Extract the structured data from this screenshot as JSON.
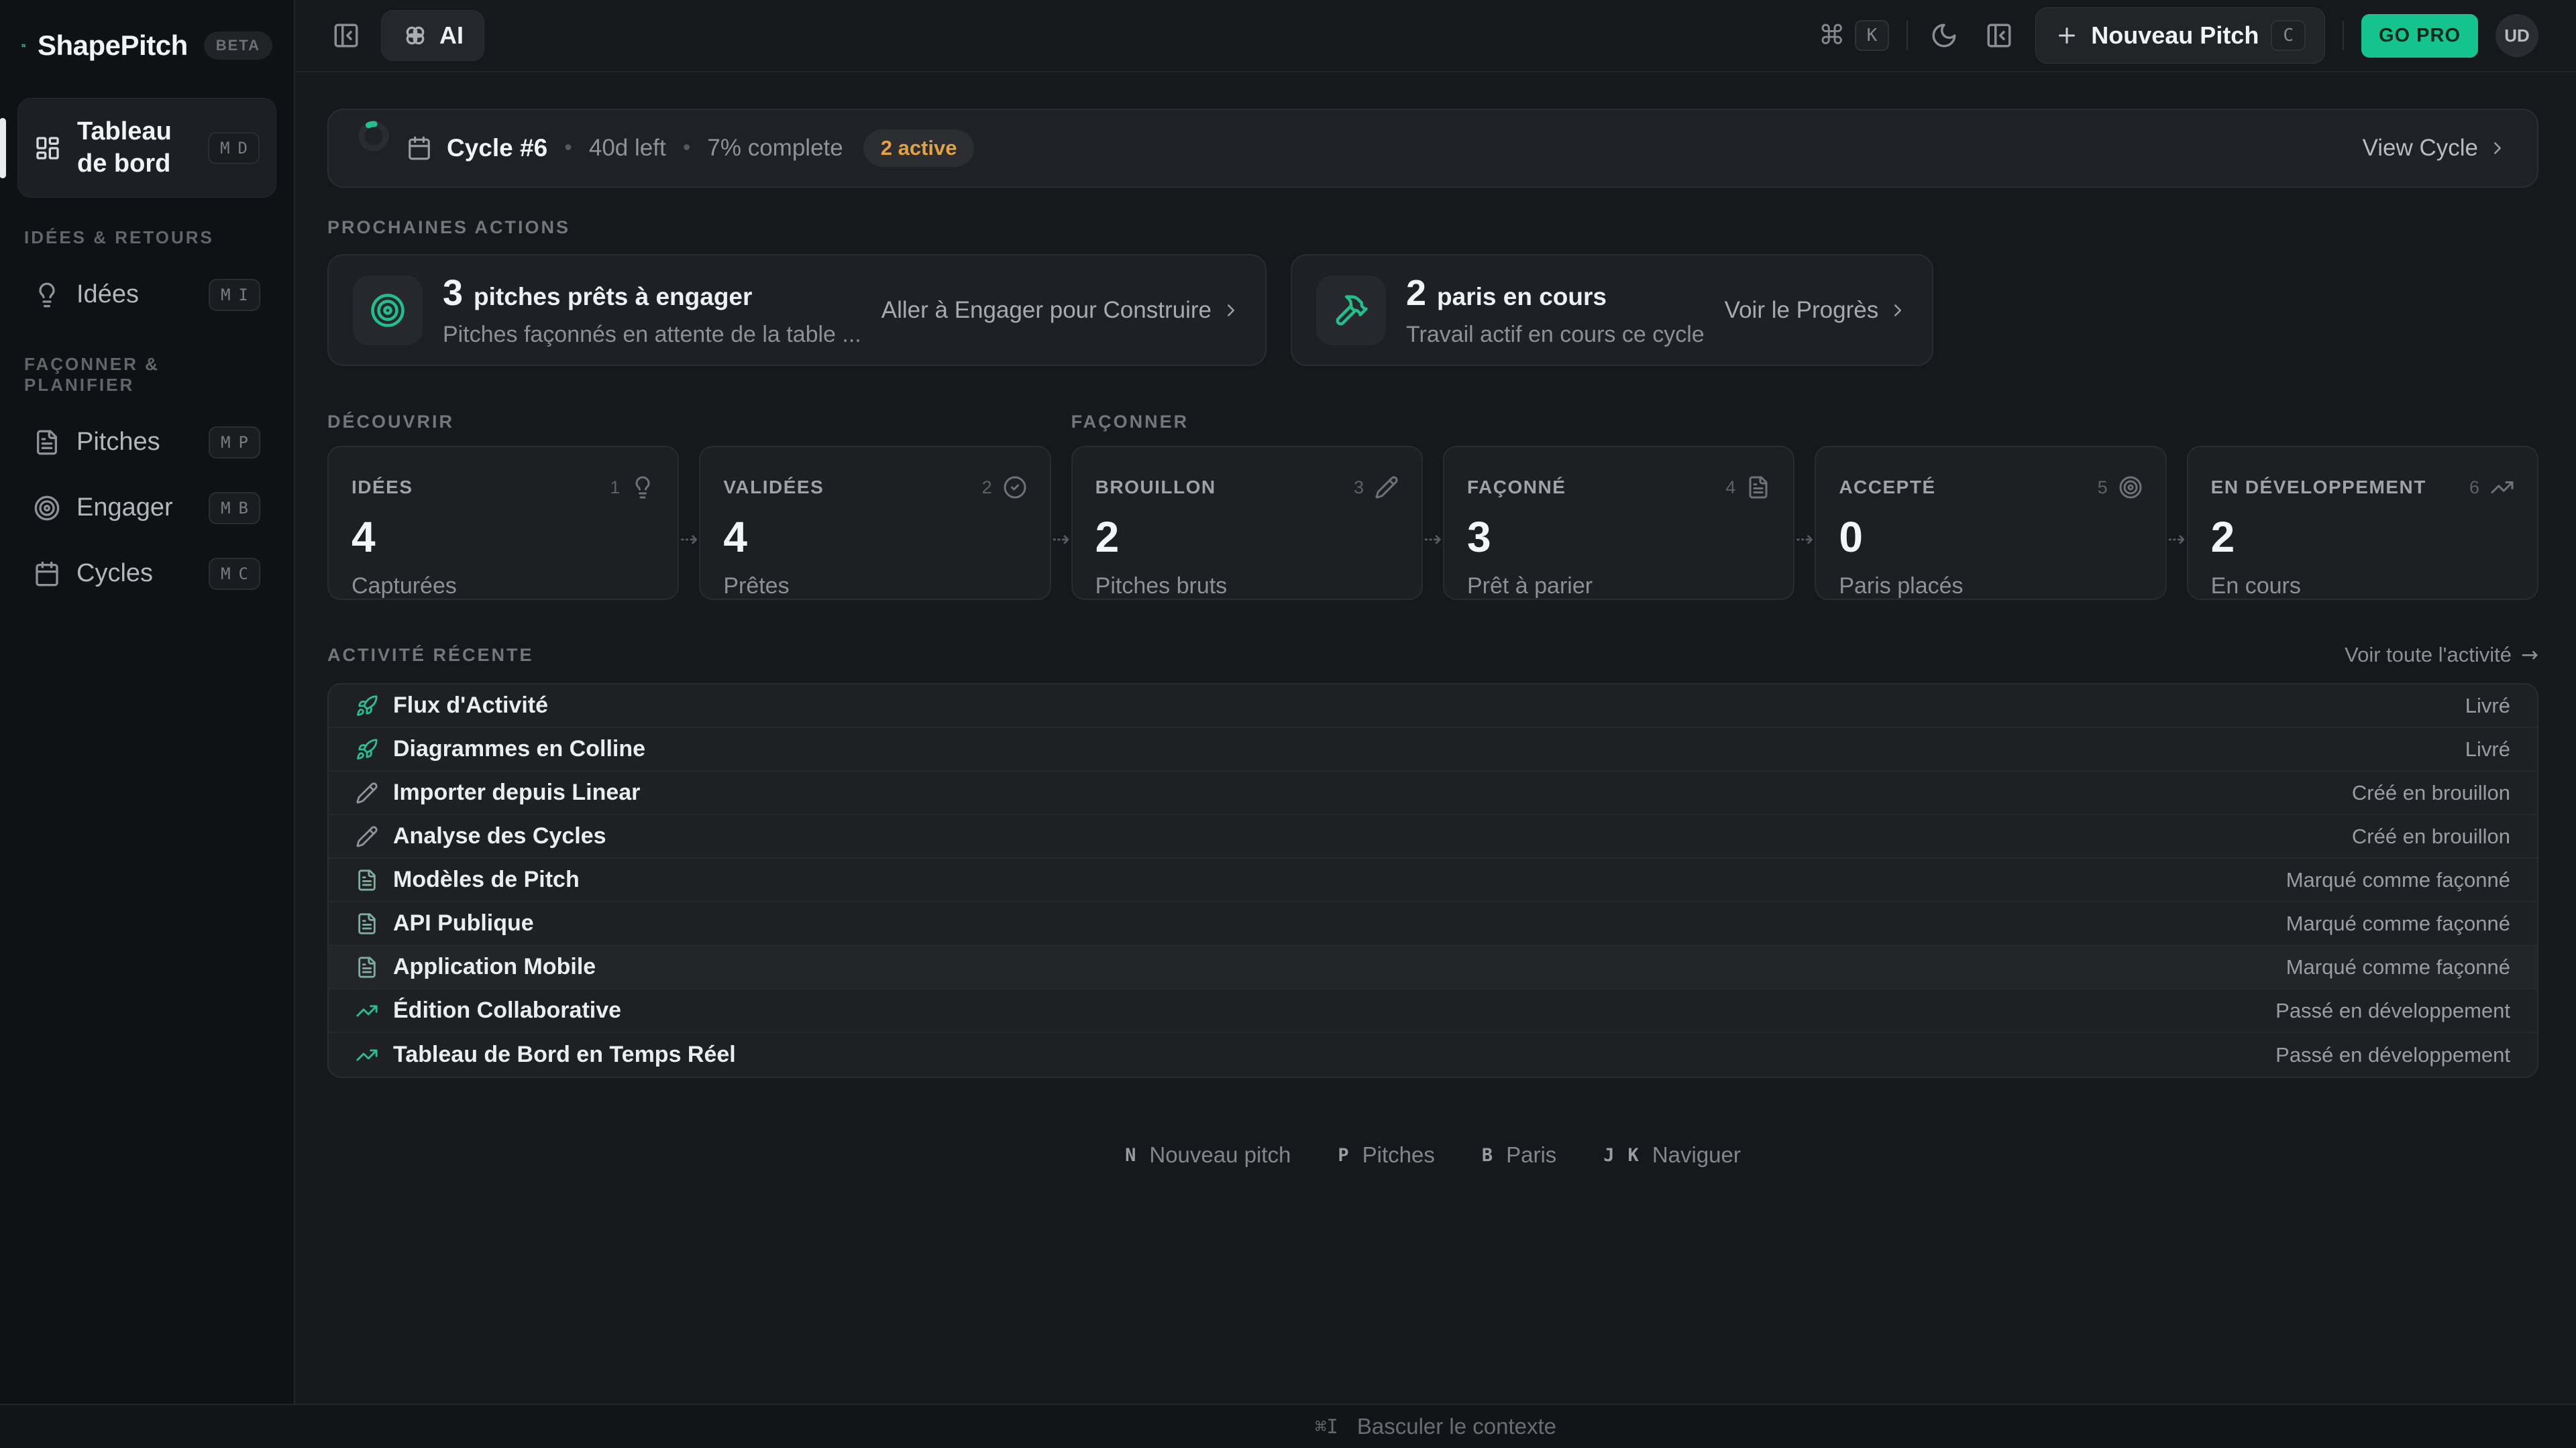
{
  "colors": {
    "accent": "#21c08b",
    "amber": "#e3a23f",
    "sidebar_bg": "#101114",
    "main_bg": "#17181c",
    "card_bg": "#1e2025"
  },
  "brand": {
    "name": "ShapePitch",
    "badge": "BETA"
  },
  "topbar": {
    "ai_label": "AI",
    "cmd_symbol": "⌘",
    "k_key": "K",
    "new_pitch_label": "Nouveau Pitch",
    "new_pitch_key": "C",
    "go_pro_label": "GO PRO",
    "avatar_initials": "UD"
  },
  "sidebar": {
    "dashboard": {
      "label": "Tableau de bord",
      "key1": "M",
      "key2": "D"
    },
    "section_ideas": "IDÉES & RETOURS",
    "idees": {
      "label": "Idées",
      "key1": "M",
      "key2": "I"
    },
    "section_shape": "FAÇONNER & PLANIFIER",
    "pitches": {
      "label": "Pitches",
      "key1": "M",
      "key2": "P"
    },
    "engager": {
      "label": "Engager",
      "key1": "M",
      "key2": "B"
    },
    "cycles": {
      "label": "Cycles",
      "key1": "M",
      "key2": "C"
    }
  },
  "cycle_banner": {
    "title": "Cycle #6",
    "dot": "•",
    "days_left": "40d left",
    "progress": "7% complete",
    "active_badge": "2 active",
    "action_label": "View Cycle"
  },
  "next_actions": {
    "section_label": "PROCHAINES ACTIONS",
    "cards": [
      {
        "count": "3",
        "title": "pitches prêts à engager",
        "subtitle": "Pitches façonnés en attente de la table ...",
        "action_label": "Aller à Engager pour Construire",
        "icon": "target-icon"
      },
      {
        "count": "2",
        "title": "paris en cours",
        "subtitle": "Travail actif en cours ce cycle",
        "action_label": "Voir le Progrès",
        "icon": "hammer-icon"
      }
    ]
  },
  "pipeline": {
    "groups": [
      {
        "label": "DÉCOUVRIR"
      },
      {
        "label": "FAÇONNER"
      }
    ],
    "flow_arrow": "⇢",
    "cards": [
      {
        "label": "IDÉES",
        "step": "1",
        "icon": "lightbulb-icon",
        "value": "4",
        "sublabel": "Capturées"
      },
      {
        "label": "VALIDÉES",
        "step": "2",
        "icon": "check-circle-icon",
        "value": "4",
        "sublabel": "Prêtes"
      },
      {
        "label": "BROUILLON",
        "step": "3",
        "icon": "pencil-icon",
        "value": "2",
        "sublabel": "Pitches bruts"
      },
      {
        "label": "FAÇONNÉ",
        "step": "4",
        "icon": "file-text-icon",
        "value": "3",
        "sublabel": "Prêt à parier"
      },
      {
        "label": "ACCEPTÉ",
        "step": "5",
        "icon": "target-icon",
        "value": "0",
        "sublabel": "Paris placés"
      },
      {
        "label": "EN DÉVELOPPEMENT",
        "step": "6",
        "icon": "trending-up-icon",
        "value": "2",
        "sublabel": "En cours"
      }
    ]
  },
  "activity": {
    "section_label": "ACTIVITÉ RÉCENTE",
    "view_all": "Voir toute l'activité",
    "arrow": "→",
    "rows": [
      {
        "title": "Flux d'Activité",
        "status": "Livré",
        "icon": "rocket-icon"
      },
      {
        "title": "Diagrammes en Colline",
        "status": "Livré",
        "icon": "rocket-icon"
      },
      {
        "title": "Importer depuis Linear",
        "status": "Créé en brouillon",
        "icon": "pencil-icon"
      },
      {
        "title": "Analyse des Cycles",
        "status": "Créé en brouillon",
        "icon": "pencil-icon"
      },
      {
        "title": "Modèles de Pitch",
        "status": "Marqué comme façonné",
        "icon": "file-text-icon"
      },
      {
        "title": "API Publique",
        "status": "Marqué comme façonné",
        "icon": "file-text-icon"
      },
      {
        "title": "Application Mobile",
        "status": "Marqué comme façonné",
        "icon": "file-text-icon"
      },
      {
        "title": "Édition Collaborative",
        "status": "Passé en développement",
        "icon": "trending-up-icon"
      },
      {
        "title": "Tableau de Bord en Temps Réel",
        "status": "Passé en développement",
        "icon": "trending-up-icon"
      }
    ]
  },
  "hints": {
    "items": [
      {
        "keys": [
          "N"
        ],
        "label": "Nouveau pitch"
      },
      {
        "keys": [
          "P"
        ],
        "label": "Pitches"
      },
      {
        "keys": [
          "B"
        ],
        "label": "Paris"
      },
      {
        "keys": [
          "J",
          "K"
        ],
        "label": "Naviguer"
      }
    ]
  },
  "bottom_bar": {
    "shortcut": "⌘I",
    "label": "Basculer le contexte"
  }
}
